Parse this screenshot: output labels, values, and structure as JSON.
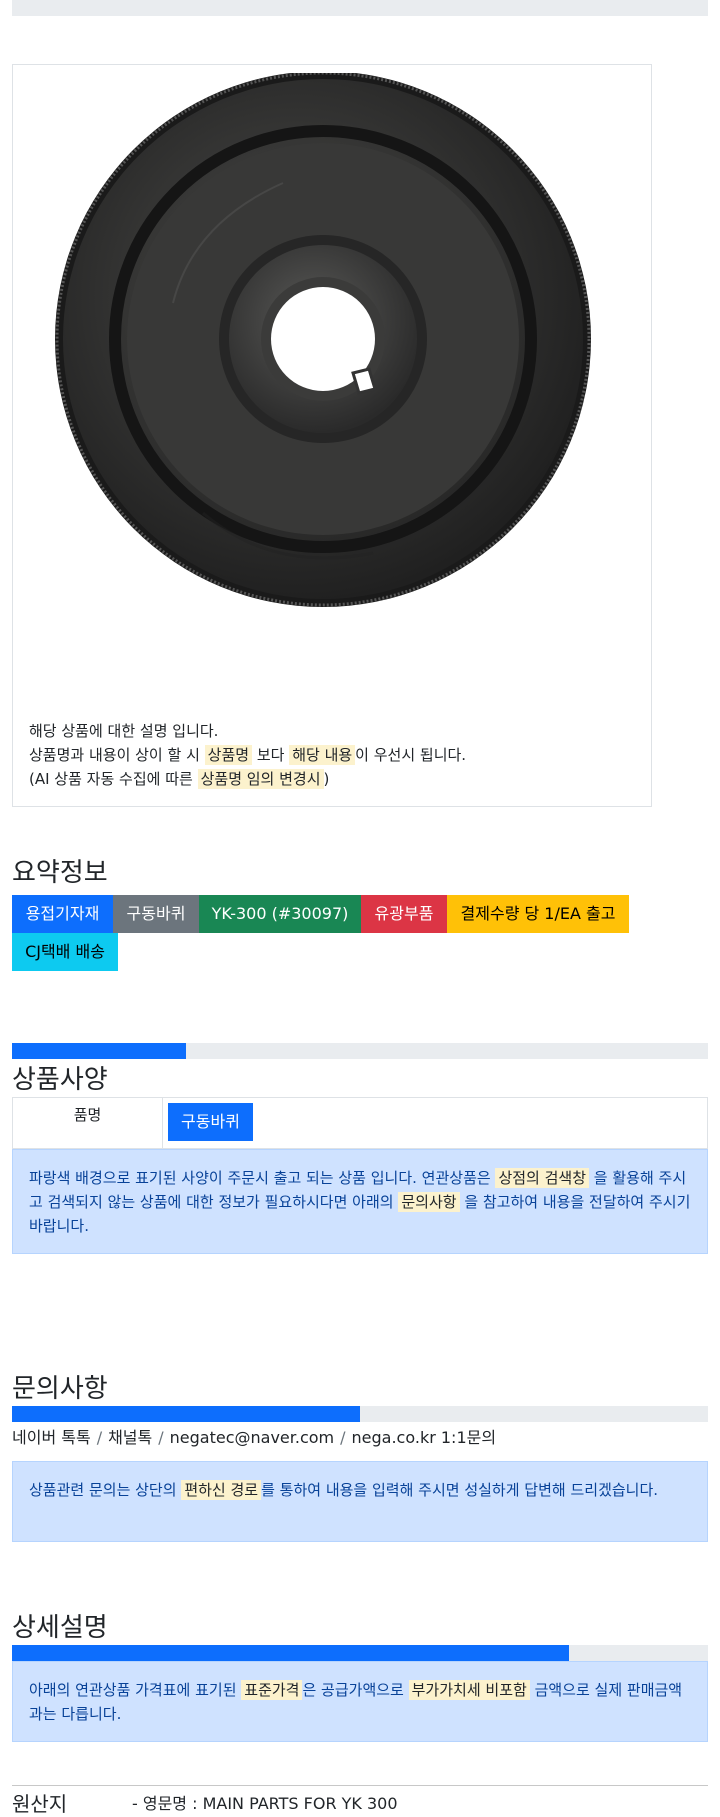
{
  "product": {
    "image_alt": "구동바퀴 product photo",
    "desc_line1": "해당 상품에 대한 설명 입니다.",
    "desc_line2_a": "상품명과 내용이 상이 할 시 ",
    "desc_line2_mark1": "상품명",
    "desc_line2_b": " 보다 ",
    "desc_line2_mark2": "해당 내용",
    "desc_line2_c": "이 우선시 됩니다.",
    "desc_line3_a": "(AI 상품 자동 수집에 따른 ",
    "desc_line3_mark": "상품명 임의 변경시",
    "desc_line3_b": ")"
  },
  "summary": {
    "title": "요약정보",
    "badges": [
      "용접기자재",
      "구동바퀴",
      "YK-300 (#30097)",
      "유광부품",
      "결제수량 당 1/EA 출고",
      "CJ택배 배송"
    ],
    "progress": 0.25
  },
  "spec": {
    "title": "상품사양",
    "progress": 0.25,
    "label": "품명",
    "value": "구동바퀴",
    "notice_a": "파랑색 배경으로 표기된 사양이 주문시 출고 되는 상품 입니다. 연관상품은 ",
    "notice_mark1": "상점의 검색창",
    "notice_b": " 을 활용해 주시고 검색되지 않는 상품에 대한 정보가 필요하시다면 아래의 ",
    "notice_mark2": "문의사항",
    "notice_c": " 을 참고하여 내용을 전달하여 주시기 바랍니다."
  },
  "inquiry": {
    "title": "문의사항",
    "progress": 0.5,
    "links": [
      "네이버 톡톡",
      "채널톡",
      "negatec@naver.com",
      "nega.co.kr 1:1문의"
    ],
    "separator": "/",
    "notice_a": "상품관련 문의는 상단의 ",
    "notice_mark": "편하신 경로",
    "notice_b": "를 통하여 내용을 입력해 주시면 성실하게 답변해 드리겠습니다."
  },
  "detail": {
    "title": "상세설명",
    "progress": 0.8,
    "notice_a": "아래의 연관상품 가격표에 표기된 ",
    "notice_mark1": "표준가격",
    "notice_b": "은 공급가액으로 ",
    "notice_mark2": "부가가치세 비포함",
    "notice_c": " 금액으로 실제 판매금액과는 다릅니다."
  },
  "origin": {
    "label": "원산지",
    "value": "- 영문명 : MAIN PARTS FOR YK 300"
  },
  "colors": {
    "primary": "#0d6efd",
    "secondary": "#6c757d",
    "success": "#198754",
    "danger": "#dc3545",
    "warning": "#ffc107",
    "info": "#0dcaf0",
    "alert_bg": "#cfe2ff",
    "mark_bg": "#fcf2cd"
  }
}
